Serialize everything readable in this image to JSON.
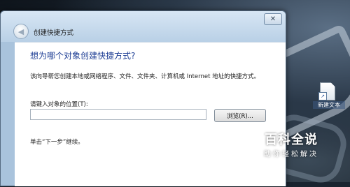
{
  "window": {
    "title": "创建快捷方式",
    "close_label": "✕",
    "back_icon": "back-arrow-icon"
  },
  "wizard": {
    "heading": "想为哪个对象创建快捷方式?",
    "description": "该向导帮您创建本地或网络程序、文件、文件夹、计算机或 Internet 地址的快捷方式。",
    "location_label": "请键入对象的位置(T):",
    "location_value": "",
    "browse_label": "浏览(R)...",
    "hint": "单击“下一步”继续。"
  },
  "desktop": {
    "icon_label": "新建文本"
  },
  "watermark": {
    "main": "百科全说",
    "sub": "助你轻松解决"
  },
  "colors": {
    "heading": "#1f3f95",
    "titlebar": "#c8dbee"
  }
}
